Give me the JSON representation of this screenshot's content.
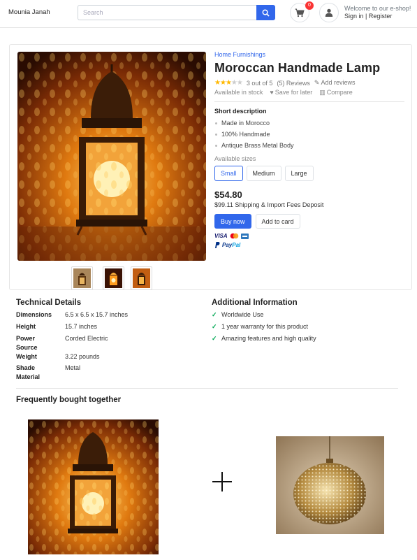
{
  "header": {
    "brand": "Mounia Janah",
    "search_placeholder": "Search",
    "cart_count": "0",
    "welcome": "Welcome to our e-shop!",
    "auth_links": "Sign in | Register"
  },
  "product": {
    "category": "Home Furnishings",
    "title": "Moroccan Handmade Lamp",
    "rating": 3,
    "rating_max": 5,
    "rating_text": "3 out of 5",
    "reviews": "(5) Reviews",
    "add_reviews": "Add reviews",
    "availability": "Available in stock",
    "save_later": "Save for later",
    "compare": "Compare",
    "short_desc_title": "Short description",
    "short_desc": [
      "Made in Morocco",
      "100% Handmade",
      "Antique Brass Metal Body"
    ],
    "sizes_label": "Available sizes",
    "sizes": [
      "Small",
      "Medium",
      "Large"
    ],
    "selected_size": "Small",
    "price": "$54.80",
    "shipping": "$99.11 Shipping & Import Fees Deposit",
    "buy_now": "Buy now",
    "add_to_card": "Add to card",
    "payment_visa": "VISA",
    "payment_paypal_1": "Pay",
    "payment_paypal_2": "Pal"
  },
  "technical": {
    "title": "Technical Details",
    "rows": [
      {
        "k": "Dimensions",
        "v": "6.5 x 6.5 x 15.7 inches"
      },
      {
        "k": "Height",
        "v": "15.7 inches"
      },
      {
        "k": "Power Source",
        "v": "Corded Electric"
      },
      {
        "k": "Weight",
        "v": "3.22 pounds"
      },
      {
        "k": "Shade Material",
        "v": "Metal"
      }
    ]
  },
  "additional": {
    "title": "Additional Information",
    "items": [
      "Worldwide Use",
      "1 year warranty for this product",
      "Amazing features and high quality"
    ]
  },
  "fbt": {
    "title": "Frequently bought together"
  },
  "colors": {
    "primary": "#3167eb",
    "star": "#ffb800",
    "badge": "#fa3434",
    "check": "#00a854"
  }
}
